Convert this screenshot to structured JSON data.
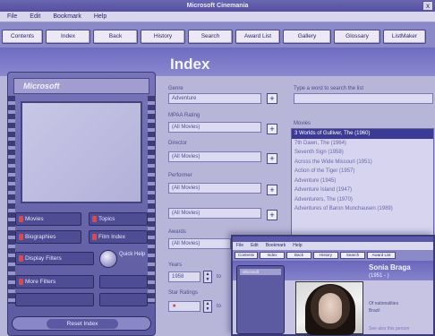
{
  "window": {
    "title": "Microsoft Cinemania",
    "close": "x"
  },
  "menu": [
    "File",
    "Edit",
    "Bookmark",
    "Help"
  ],
  "toolbar": [
    "Contents",
    "Index",
    "Back",
    "History",
    "Search",
    "Award List",
    "Gallery",
    "Glossary",
    "ListMaker"
  ],
  "page": {
    "title": "Index"
  },
  "player": {
    "logo": "Microsoft",
    "buttons": {
      "movies": "Movies",
      "topics": "Topics",
      "biographies": "Biographies",
      "film_index": "Film Index",
      "display_filters": "Display Filters",
      "quick_help": "Quick Help",
      "more_filters": "More Filters",
      "reset_index": "Reset Index"
    }
  },
  "filters": {
    "genre": {
      "label": "Genre",
      "value": "Adventure"
    },
    "mpaa": {
      "label": "MPAA Rating",
      "value": "(All Movies)"
    },
    "director": {
      "label": "Director",
      "value": "(All Movies)"
    },
    "performer": {
      "label": "Performer",
      "value": "(All Movies)"
    },
    "row5": {
      "value": "(All Movies)"
    },
    "awards": {
      "label": "Awards",
      "value": "(All Movies)"
    },
    "years": {
      "label": "Years",
      "value": "1958",
      "to": "to"
    },
    "star_ratings": {
      "label": "Star Ratings",
      "value": "★",
      "to": "to"
    }
  },
  "search": {
    "label": "Type a word to search the list",
    "list_label": "Movies"
  },
  "movies": [
    {
      "title": "3 Worlds of Gulliver, The (1960)",
      "selected": true
    },
    {
      "title": "7th Dawn, The (1964)",
      "selected": false
    },
    {
      "title": "Seventh Sign (1958)",
      "selected": false
    },
    {
      "title": "Across the Wide Missouri (1951)",
      "selected": false
    },
    {
      "title": "Action of the Tiger (1957)",
      "selected": false
    },
    {
      "title": "Adventure (1945)",
      "selected": false
    },
    {
      "title": "Adventure Island (1947)",
      "selected": false
    },
    {
      "title": "Adventurers, The (1970)",
      "selected": false
    },
    {
      "title": "Adventures of Baron Munchausen (1989)",
      "selected": false
    }
  ],
  "second_window": {
    "menu": [
      "File",
      "Edit",
      "Bookmark",
      "Help"
    ],
    "toolbar": [
      "Contents",
      "Index",
      "Back",
      "History",
      "Search",
      "Award List"
    ],
    "logo": "Microsoft",
    "person": {
      "name": "Sonia Braga",
      "dates": "(1951 -   )",
      "born_label": "Of nationalities",
      "born_value": "Brazil",
      "more": "See also this person"
    }
  }
}
